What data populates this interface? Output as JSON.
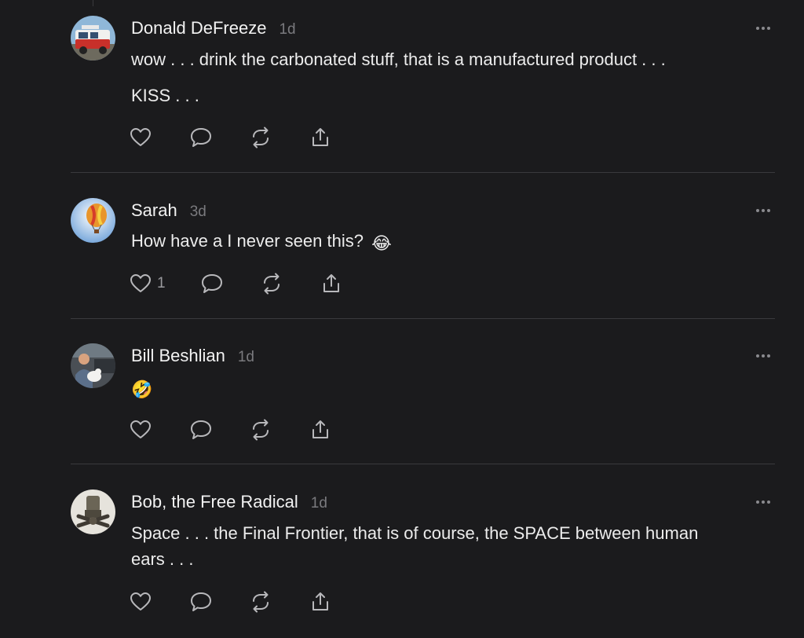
{
  "colors": {
    "background": "#1b1b1d",
    "text": "#ececec",
    "muted": "#7a7a7e",
    "divider": "#3a3a3d"
  },
  "comments": [
    {
      "author": "Donald DeFreeze",
      "time": "1d",
      "avatar": "red-van-photo",
      "lines": [
        "wow . . . drink the carbonated stuff, that is a manufactured product . . .",
        "KISS . . ."
      ],
      "likes": ""
    },
    {
      "author": "Sarah",
      "time": "3d",
      "avatar": "hot-air-balloon-photo",
      "lines": [
        "How have a I never seen this?"
      ],
      "emoji": "😂",
      "likes": "1"
    },
    {
      "author": "Bill Beshlian",
      "time": "1d",
      "avatar": "man-with-dog-photo",
      "lines": [
        ""
      ],
      "emoji": "🤣",
      "likes": ""
    },
    {
      "author": "Bob, the Free Radical",
      "time": "1d",
      "avatar": "statue-photo",
      "lines": [
        "Space . . . the Final Frontier, that is of course, the SPACE between human",
        "ears . . ."
      ],
      "likes": ""
    }
  ],
  "icons": {
    "like": "heart-icon",
    "reply": "speech-bubble-icon",
    "restack": "restack-icon",
    "share": "share-icon",
    "more": "more-dots-icon"
  }
}
